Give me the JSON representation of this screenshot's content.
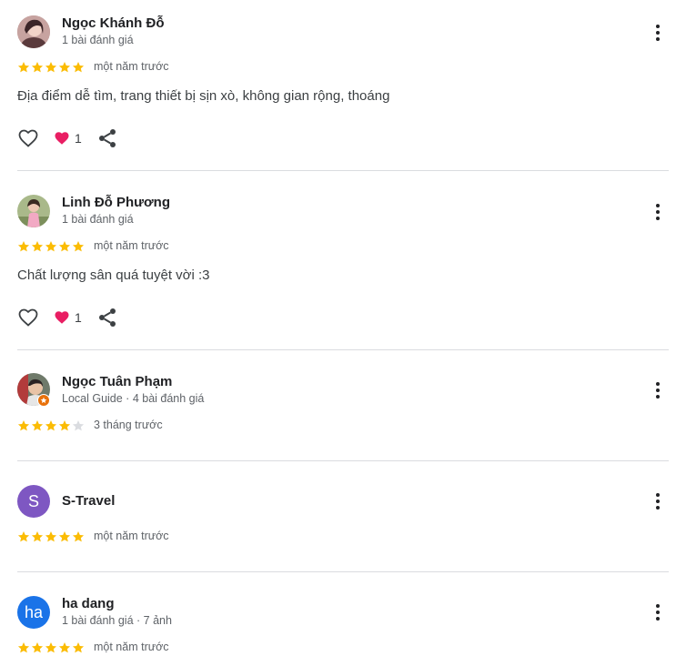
{
  "colors": {
    "star_filled": "#fbbc04",
    "star_empty": "#dadce0",
    "heart_reaction": "#e91e63",
    "avatar_s": "#7e57c2",
    "avatar_ha": "#1a73e8",
    "local_guide_badge": "#e8710a"
  },
  "reviews": [
    {
      "author": "Ngọc Khánh Đỗ",
      "meta": "1 bài đánh giá",
      "rating": 5,
      "time": "một năm trước",
      "text": "Địa điểm dễ tìm, trang thiết bị sịn xò, không gian rộng, thoáng",
      "reaction_count": "1",
      "avatar_type": "photo"
    },
    {
      "author": "Linh Đỗ Phương",
      "meta": "1 bài đánh giá",
      "rating": 5,
      "time": "một năm trước",
      "text": "Chất lượng sân quá tuyệt vời :3",
      "reaction_count": "1",
      "avatar_type": "photo"
    },
    {
      "author": "Ngọc Tuân Phạm",
      "meta": "Local Guide · 4 bài đánh giá",
      "rating": 4,
      "time": "3 tháng trước",
      "avatar_type": "photo"
    },
    {
      "author": "S-Travel",
      "rating": 5,
      "time": "một năm trước",
      "avatar_letter": "S",
      "avatar_type": "letter"
    },
    {
      "author": "ha dang",
      "meta": "1 bài đánh giá · 7 ảnh",
      "rating": 5,
      "time": "một năm trước",
      "avatar_letter": "ha",
      "avatar_type": "letter"
    }
  ],
  "icons": {
    "more": "more-vert-icon",
    "like": "heart-outline-icon",
    "reaction": "heart-filled-icon",
    "share": "share-icon",
    "star": "star-icon"
  }
}
